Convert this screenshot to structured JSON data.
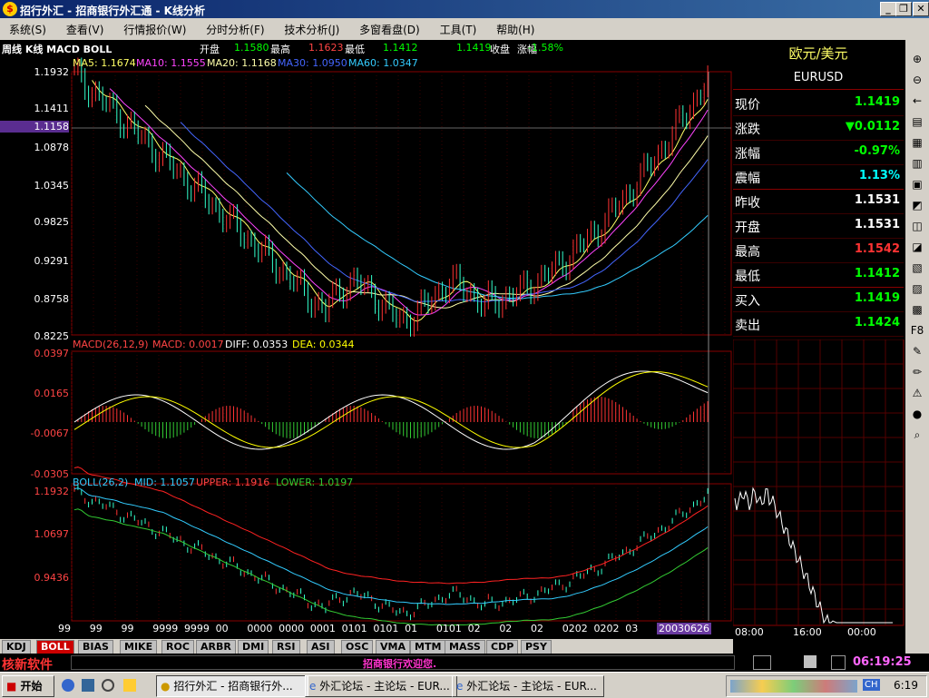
{
  "window": {
    "title": "招行外汇 - 招商银行外汇通 - K线分析"
  },
  "menu": [
    "系统(S)",
    "查看(V)",
    "行情报价(W)",
    "分时分析(F)",
    "技术分析(J)",
    "多窗看盘(D)",
    "工具(T)",
    "帮助(H)"
  ],
  "chart_header": {
    "period": "周线 K线 MACD BOLL",
    "open_label": "开盘",
    "open": "1.1580",
    "high_label": "最高",
    "high": "1.1623",
    "low_label": "最低",
    "low": "1.1412",
    "close_label": "收盘",
    "close": "1.1419",
    "change_label": "涨幅",
    "change": "-1.58%"
  },
  "ma": {
    "ma5": "MA5: 1.1674",
    "ma10": "MA10: 1.1555",
    "ma20": "MA20: 1.1168",
    "ma30": "MA30: 1.0950",
    "ma60": "MA60: 1.0347"
  },
  "price_axis": [
    "1.1932",
    "1.1411",
    "1.1158",
    "1.0878",
    "1.0345",
    "0.9825",
    "0.9291",
    "0.8758",
    "0.8225"
  ],
  "macd": {
    "title": "MACD(26,12,9)",
    "macd": "MACD: 0.0017",
    "diff": "DIFF: 0.0353",
    "dea": "DEA: 0.0344",
    "axis": [
      "0.0397",
      "0.0165",
      "-0.0067",
      "-0.0305"
    ]
  },
  "boll": {
    "title": "BOLL(26,2)",
    "mid": "MID: 1.1057",
    "upper": "UPPER: 1.1916",
    "lower": "LOWER: 1.0197",
    "axis": [
      "1.1932",
      "1.0697",
      "0.9436"
    ]
  },
  "x_axis": [
    "99",
    "99",
    "99",
    "9999",
    "9999",
    "00",
    "0000",
    "0000",
    "0001",
    "0101",
    "0101",
    "01",
    "0101",
    "02",
    "02",
    "02",
    "0202",
    "0202",
    "03"
  ],
  "x_current": "20030626",
  "quote": {
    "pair": "欧元/美元",
    "symbol": "EURUSD",
    "rows": [
      {
        "k": "现价",
        "v": "1.1419",
        "color": "#00ff00"
      },
      {
        "k": "涨跌",
        "v": "▼0.0112",
        "color": "#00ff00"
      },
      {
        "k": "涨幅",
        "v": "-0.97%",
        "color": "#00ff00"
      },
      {
        "k": "震幅",
        "v": "1.13%",
        "color": "#00ffff"
      },
      {
        "k": "昨收",
        "v": "1.1531",
        "color": "#ffffff"
      },
      {
        "k": "开盘",
        "v": "1.1531",
        "color": "#ffffff"
      },
      {
        "k": "最高",
        "v": "1.1542",
        "color": "#ff3333"
      },
      {
        "k": "最低",
        "v": "1.1412",
        "color": "#00ff00"
      },
      {
        "k": "买入",
        "v": "1.1419",
        "color": "#00ff00"
      },
      {
        "k": "卖出",
        "v": "1.1424",
        "color": "#00ff00"
      }
    ],
    "time_axis": [
      "08:00",
      "16:00",
      "00:00"
    ]
  },
  "tabs": [
    "KDJ",
    "BOLL",
    "BIAS",
    "MIKE",
    "ROC",
    "ARBR",
    "DMI",
    "RSI",
    "ASI",
    "OSC",
    "VMA",
    "MTM",
    "MASS",
    "CDP",
    "PSY"
  ],
  "active_tab": "BOLL",
  "status": {
    "brand": "核新软件",
    "welcome": "招商银行欢迎您.",
    "time": "06:19:25"
  },
  "taskbar": {
    "start": "开始",
    "tasks": [
      "招行外汇 - 招商银行外...",
      "外汇论坛 - 主论坛 - EUR...",
      "外汇论坛 - 主论坛 - EUR..."
    ],
    "clock": "6:19",
    "lang": "CH"
  },
  "toolbar_icons": [
    "zoom-in-icon",
    "zoom-out-icon",
    "arrow-left-icon",
    "report-icon",
    "list-icon",
    "grid-icon",
    "chart-icon",
    "chart-2-icon",
    "bar-icon",
    "bar-2-icon",
    "table-icon",
    "candles-icon",
    "note-icon",
    "f8-icon",
    "brush-icon",
    "pen-icon",
    "warning-icon",
    "circle-icon",
    "search-icon"
  ]
}
